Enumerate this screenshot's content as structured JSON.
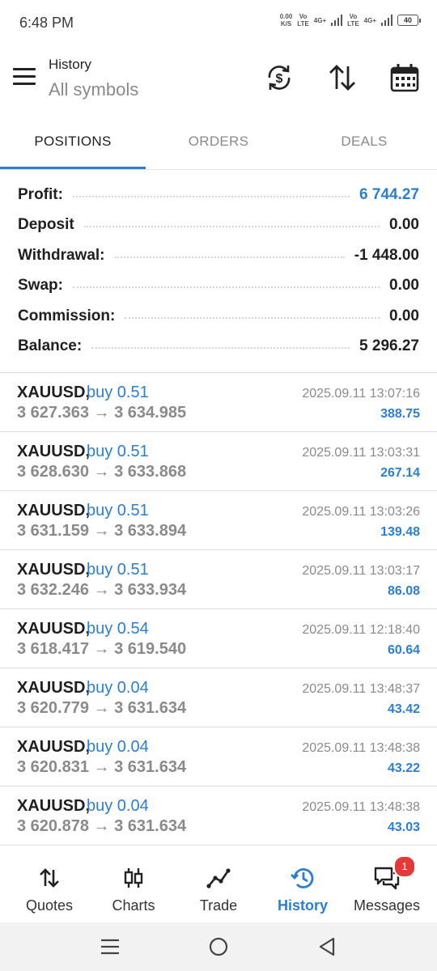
{
  "status_bar": {
    "time": "6:48 PM",
    "speed_value": "0.00",
    "speed_unit": "K/S",
    "sim1_top": "Vo",
    "sim1_bottom": "LTE",
    "net1": "4G+",
    "sim2_top": "Vo",
    "sim2_bottom": "LTE",
    "net2": "4G+",
    "battery": "40"
  },
  "header": {
    "title": "History",
    "subtitle": "All symbols",
    "icons": [
      "menu-icon",
      "currency-refresh-icon",
      "sort-icon",
      "calendar-icon"
    ]
  },
  "tabs": [
    {
      "label": "POSITIONS",
      "active": true
    },
    {
      "label": "ORDERS",
      "active": false
    },
    {
      "label": "DEALS",
      "active": false
    }
  ],
  "summary": [
    {
      "label": "Profit:",
      "value": "6 744.27",
      "accent": true
    },
    {
      "label": "Deposit",
      "value": "0.00",
      "accent": false
    },
    {
      "label": "Withdrawal:",
      "value": "-1 448.00",
      "accent": false
    },
    {
      "label": "Swap:",
      "value": "0.00",
      "accent": false
    },
    {
      "label": "Commission:",
      "value": "0.00",
      "accent": false
    },
    {
      "label": "Balance:",
      "value": "5 296.27",
      "accent": false
    }
  ],
  "positions": [
    {
      "symbol": "XAUUSD,",
      "type": "buy 0.51",
      "prices": "3 627.363 → 3 634.985",
      "time": "2025.09.11 13:07:16",
      "profit": "388.75"
    },
    {
      "symbol": "XAUUSD,",
      "type": "buy 0.51",
      "prices": "3 628.630 → 3 633.868",
      "time": "2025.09.11 13:03:31",
      "profit": "267.14"
    },
    {
      "symbol": "XAUUSD,",
      "type": "buy 0.51",
      "prices": "3 631.159 → 3 633.894",
      "time": "2025.09.11 13:03:26",
      "profit": "139.48"
    },
    {
      "symbol": "XAUUSD,",
      "type": "buy 0.51",
      "prices": "3 632.246 → 3 633.934",
      "time": "2025.09.11 13:03:17",
      "profit": "86.08"
    },
    {
      "symbol": "XAUUSD,",
      "type": "buy 0.54",
      "prices": "3 618.417 → 3 619.540",
      "time": "2025.09.11 12:18:40",
      "profit": "60.64"
    },
    {
      "symbol": "XAUUSD,",
      "type": "buy 0.04",
      "prices": "3 620.779 → 3 631.634",
      "time": "2025.09.11 13:48:37",
      "profit": "43.42"
    },
    {
      "symbol": "XAUUSD,",
      "type": "buy 0.04",
      "prices": "3 620.831 → 3 631.634",
      "time": "2025.09.11 13:48:38",
      "profit": "43.22"
    },
    {
      "symbol": "XAUUSD,",
      "type": "buy 0.04",
      "prices": "3 620.878 → 3 631.634",
      "time": "2025.09.11 13:48:38",
      "profit": "43.03"
    }
  ],
  "bottom_nav": [
    {
      "label": "Quotes",
      "icon": "quotes-icon",
      "active": false
    },
    {
      "label": "Charts",
      "icon": "charts-icon",
      "active": false
    },
    {
      "label": "Trade",
      "icon": "trade-icon",
      "active": false
    },
    {
      "label": "History",
      "icon": "history-icon",
      "active": true
    },
    {
      "label": "Messages",
      "icon": "messages-icon",
      "active": false,
      "badge": "1"
    }
  ],
  "colors": {
    "accent": "#2a7fd4",
    "badge": "#e53935",
    "muted": "#8a8a8a"
  }
}
